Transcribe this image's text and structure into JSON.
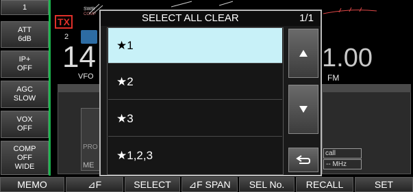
{
  "left_menu": [
    {
      "line1": "1",
      "line2": "",
      "line3": ""
    },
    {
      "line1": "ATT",
      "line2": "6dB",
      "line3": ""
    },
    {
      "line1": "IP+",
      "line2": "OFF",
      "line3": ""
    },
    {
      "line1": "AGC",
      "line2": "SLOW",
      "line3": ""
    },
    {
      "line1": "VOX",
      "line2": "OFF",
      "line3": ""
    },
    {
      "line1": "COMP",
      "line2": "OFF",
      "line3": "WIDE"
    }
  ],
  "background": {
    "tx_label": "TX",
    "vfo_digit": "14",
    "vfo_label": "VFO",
    "freq_tail": "1.00",
    "mode": "FM",
    "swr_label": "SWR",
    "comp_label": "COMP",
    "pro_label": "PRO",
    "me_label": "ME",
    "recall_label": "call",
    "mhz_label": "-- MHz",
    "two_label": "2"
  },
  "dialog": {
    "title": "SELECT ALL CLEAR",
    "page": "1/1",
    "items": [
      "★1",
      "★2",
      "★3",
      "★1,2,3"
    ],
    "selected_index": 0,
    "up_icon": "triangle-up-icon",
    "down_icon": "triangle-down-icon",
    "back_icon": "return-icon"
  },
  "bottom_bar": [
    "MEMO",
    "⊿F",
    "SELECT",
    "⊿F SPAN",
    "SEL No.",
    "RECALL",
    "SET"
  ]
}
